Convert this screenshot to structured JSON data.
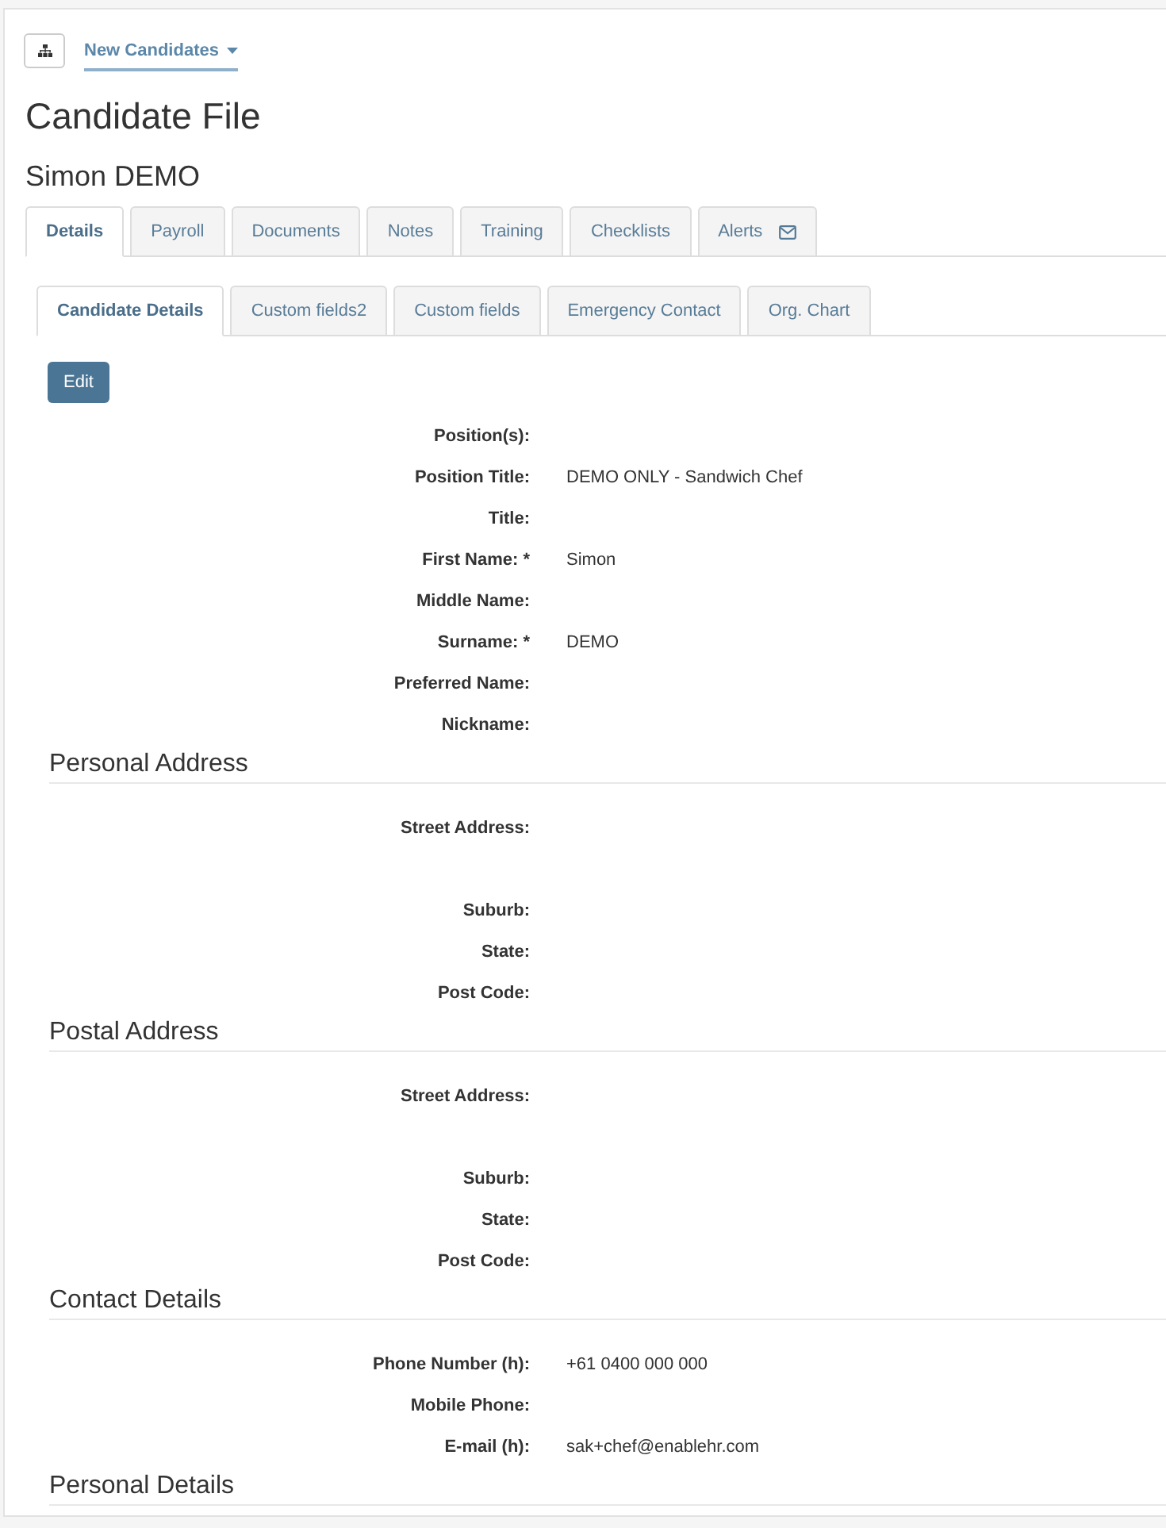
{
  "toolbar": {
    "breadcrumb_menu": {
      "label": "New Candidates"
    }
  },
  "page_title": "Candidate File",
  "candidate_name": "Simon DEMO",
  "tabs": [
    {
      "label": "Details",
      "selected": true,
      "kind": "text"
    },
    {
      "label": "Payroll",
      "selected": false,
      "kind": "text"
    },
    {
      "label": "Documents",
      "selected": false,
      "kind": "text"
    },
    {
      "label": "Notes",
      "selected": false,
      "kind": "text"
    },
    {
      "label": "Training",
      "selected": false,
      "kind": "text"
    },
    {
      "label": "Checklists",
      "selected": false,
      "kind": "text"
    },
    {
      "label": "Alerts",
      "selected": false,
      "kind": "text_icon"
    }
  ],
  "subtabs": [
    {
      "label": "Candidate Details",
      "selected": true
    },
    {
      "label": "Custom fields2",
      "selected": false
    },
    {
      "label": "Custom fields",
      "selected": false
    },
    {
      "label": "Emergency Contact",
      "selected": false
    },
    {
      "label": "Org. Chart",
      "selected": false
    }
  ],
  "edit_button": {
    "label": "Edit"
  },
  "sections": [
    {
      "fields": [
        {
          "label": "Position(s):",
          "kind": "line"
        },
        {
          "label": "Position Title:",
          "value": "DEMO ONLY - Sandwich Chef",
          "kind": "line"
        },
        {
          "label": "Title:",
          "kind": "line"
        },
        {
          "label": "First Name: *",
          "value": "Simon",
          "kind": "line"
        },
        {
          "label": "Middle Name:",
          "kind": "line"
        },
        {
          "label": "Surname: *",
          "value": "DEMO",
          "kind": "line"
        },
        {
          "label": "Preferred Name:",
          "kind": "line"
        },
        {
          "label": "Nickname:",
          "kind": "line"
        }
      ]
    },
    {
      "heading": "Personal Address",
      "fields": [
        {
          "label": "Street Address:",
          "kind": "multiline"
        },
        {
          "label": "Suburb:",
          "kind": "line"
        },
        {
          "label": "State:",
          "kind": "line"
        },
        {
          "label": "Post Code:",
          "kind": "line"
        }
      ]
    },
    {
      "heading": "Postal Address",
      "fields": [
        {
          "label": "Street Address:",
          "kind": "multiline"
        },
        {
          "label": "Suburb:",
          "kind": "line"
        },
        {
          "label": "State:",
          "kind": "line"
        },
        {
          "label": "Post Code:",
          "kind": "line"
        }
      ]
    },
    {
      "heading": "Contact Details",
      "fields": [
        {
          "label": "Phone Number (h):",
          "value": "+61 0400 000 000",
          "kind": "line"
        },
        {
          "label": "Mobile Phone:",
          "kind": "line"
        },
        {
          "label": "E-mail (h):",
          "value": "sak+chef@enablehr.com",
          "kind": "line"
        }
      ]
    },
    {
      "heading": "Personal Details"
    }
  ]
}
